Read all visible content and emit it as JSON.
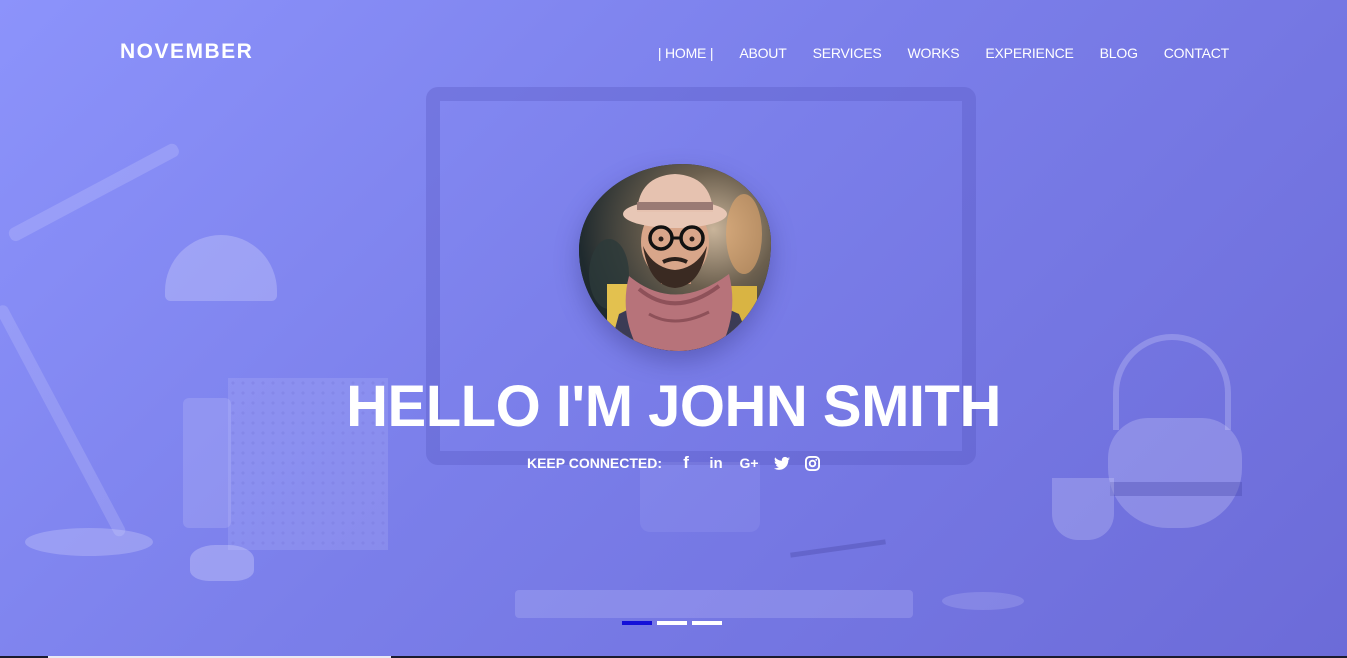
{
  "brand": {
    "name": "NOVEMBER"
  },
  "nav": {
    "items": [
      {
        "label": "HOME",
        "active": true
      },
      {
        "label": "ABOUT",
        "active": false
      },
      {
        "label": "SERVICES",
        "active": false
      },
      {
        "label": "WORKS",
        "active": false
      },
      {
        "label": "EXPERIENCE",
        "active": false
      },
      {
        "label": "BLOG",
        "active": false
      },
      {
        "label": "CONTACT",
        "active": false
      }
    ]
  },
  "hero": {
    "title": "HELLO I'M JOHN SMITH",
    "social_label": "KEEP CONNECTED:",
    "social_links": [
      {
        "icon": "facebook-icon",
        "glyph": "f"
      },
      {
        "icon": "linkedin-icon",
        "glyph": "in"
      },
      {
        "icon": "google-plus-icon",
        "glyph": "G+"
      },
      {
        "icon": "twitter-icon",
        "glyph": ""
      },
      {
        "icon": "instagram-icon",
        "glyph": ""
      }
    ]
  },
  "slider": {
    "slide_count": 3,
    "active_index": 0
  },
  "colors": {
    "background_start": "#8c93fb",
    "background_end": "#6c6bd8",
    "text": "#ffffff",
    "active_dot": "#1410d8"
  }
}
